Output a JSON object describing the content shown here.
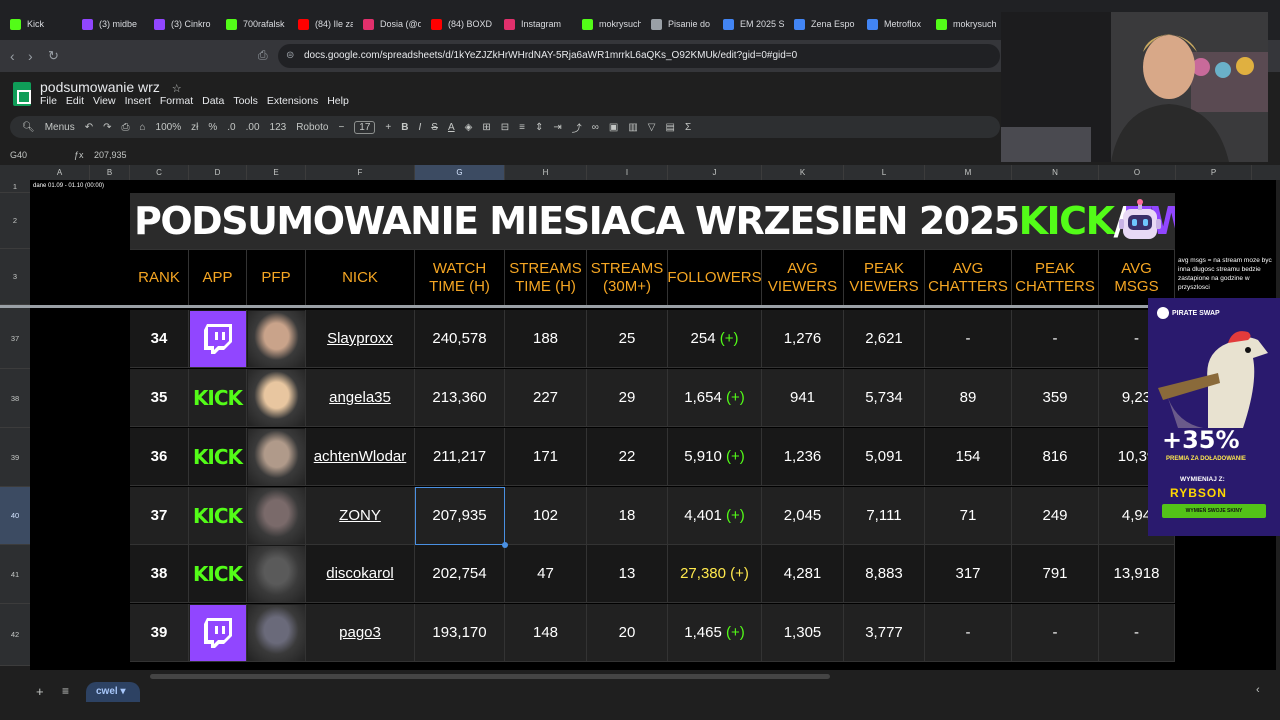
{
  "browser": {
    "tabs": [
      {
        "label": "Kick",
        "color": "#53fc18"
      },
      {
        "label": "(3) midbe",
        "color": "#9146ff"
      },
      {
        "label": "(3) Cinkro",
        "color": "#9146ff"
      },
      {
        "label": "700rafalsk",
        "color": "#53fc18"
      },
      {
        "label": "(84) Ile zar",
        "color": "#ff0000"
      },
      {
        "label": "Dosia (@d",
        "color": "#e1306c"
      },
      {
        "label": "(84) BOXD",
        "color": "#ff0000"
      },
      {
        "label": "Instagram",
        "color": "#e1306c"
      },
      {
        "label": "mokrysuch",
        "color": "#53fc18"
      },
      {
        "label": "Pisanie do",
        "color": "#9aa0a6"
      },
      {
        "label": "EM 2025 S",
        "color": "#4285f4"
      },
      {
        "label": "Zena Espo",
        "color": "#4285f4"
      },
      {
        "label": "Metroflox",
        "color": "#4285f4"
      },
      {
        "label": "mokrysuch",
        "color": "#53fc18"
      }
    ],
    "url": "docs.google.com/spreadsheets/d/1kYeZJZkHrWHrdNAY-5Rja6aWR1mrrkL6aQKs_O92KMUk/edit?gid=0#gid=0"
  },
  "sheet": {
    "title": "podsumowanie wrz",
    "menus": [
      "File",
      "Edit",
      "View",
      "Insert",
      "Format",
      "Data",
      "Tools",
      "Extensions",
      "Help"
    ],
    "toolbar": {
      "search": "Menus",
      "zoom": "100%",
      "font": "Roboto",
      "font_size": "17",
      "currency": "zł",
      "percent": "%",
      "dec_less": ".0",
      "dec_more": ".00",
      "number_format": "123"
    },
    "cell_ref": "G40",
    "formula_value": "207,935",
    "columns": [
      "A",
      "B",
      "C",
      "D",
      "E",
      "F",
      "G",
      "H",
      "I",
      "J",
      "K",
      "L",
      "M",
      "N",
      "O",
      "P"
    ],
    "row_numbers": [
      "1",
      "2",
      "3",
      "37",
      "38",
      "39",
      "40",
      "41",
      "42"
    ],
    "note_row1": "dane 01.09 - 01.10 (00:00)",
    "side_note": "avg msgs = na stream moze byc inna dlugosc streamu bedzie zastapione na godzine w przyszlosci",
    "sheet_tab": "cwel"
  },
  "banner": {
    "part1": "PODSUMOWANIE MIESIACA WRZESIEN 2025 ",
    "kick": "KICK",
    "slash": "/",
    "twitch": "TWITCH"
  },
  "headers": [
    "RANK",
    "APP",
    "PFP",
    "NICK",
    "WATCH TIME (H)",
    "STREAMS TIME (H)",
    "STREAMS (30M+)",
    "FOLLOWERS",
    "AVG VIEWERS",
    "PEAK VIEWERS",
    "AVG CHATTERS",
    "PEAK CHATTERS",
    "AVG MSGS"
  ],
  "rows": [
    {
      "rank": "34",
      "app": "twitch",
      "nick": "Slayproxx",
      "watch": "240,578",
      "stime": "188",
      "streams": "25",
      "followers": "254",
      "plus": "(+)",
      "avgv": "1,276",
      "peakv": "2,621",
      "avgc": "-",
      "peakc": "-",
      "msgs": "-"
    },
    {
      "rank": "35",
      "app": "kick",
      "nick": "angela35",
      "watch": "213,360",
      "stime": "227",
      "streams": "29",
      "followers": "1,654",
      "plus": "(+)",
      "avgv": "941",
      "peakv": "5,734",
      "avgc": "89",
      "peakc": "359",
      "msgs": "9,23"
    },
    {
      "rank": "36",
      "app": "kick",
      "nick": "achtenWlodar",
      "watch": "211,217",
      "stime": "171",
      "streams": "22",
      "followers": "5,910",
      "plus": "(+)",
      "avgv": "1,236",
      "peakv": "5,091",
      "avgc": "154",
      "peakc": "816",
      "msgs": "10,39"
    },
    {
      "rank": "37",
      "app": "kick",
      "nick": "ZONY",
      "watch": "207,935",
      "stime": "102",
      "streams": "18",
      "followers": "4,401",
      "plus": "(+)",
      "avgv": "2,045",
      "peakv": "7,111",
      "avgc": "71",
      "peakc": "249",
      "msgs": "4,94"
    },
    {
      "rank": "38",
      "app": "kick",
      "nick": "discokarol",
      "watch": "202,754",
      "stime": "47",
      "streams": "13",
      "followers": "27,380",
      "plus": "(+)",
      "avgv": "4,281",
      "peakv": "8,883",
      "avgc": "317",
      "peakc": "791",
      "msgs": "13,918"
    },
    {
      "rank": "39",
      "app": "twitch",
      "nick": "pago3",
      "watch": "193,170",
      "stime": "148",
      "streams": "20",
      "followers": "1,465",
      "plus": "(+)",
      "avgv": "1,305",
      "peakv": "3,777",
      "avgc": "-",
      "peakc": "-",
      "msgs": "-"
    }
  ],
  "app_labels": {
    "kick": "KICK"
  },
  "ad": {
    "brand": "PIRATE SWAP",
    "percent": "+35%",
    "subtitle": "PREMIA ZA DOŁADOWANIE",
    "exchange": "WYMIENIAJ Z:",
    "code": "RYBSON",
    "button": "WYMIEŃ SWOJE SKINY"
  },
  "colors": {
    "kick_green": "#53fc18",
    "twitch_purple": "#9146ff",
    "header_orange": "#f5a623",
    "highlight_yellow": "#ffe94d"
  }
}
